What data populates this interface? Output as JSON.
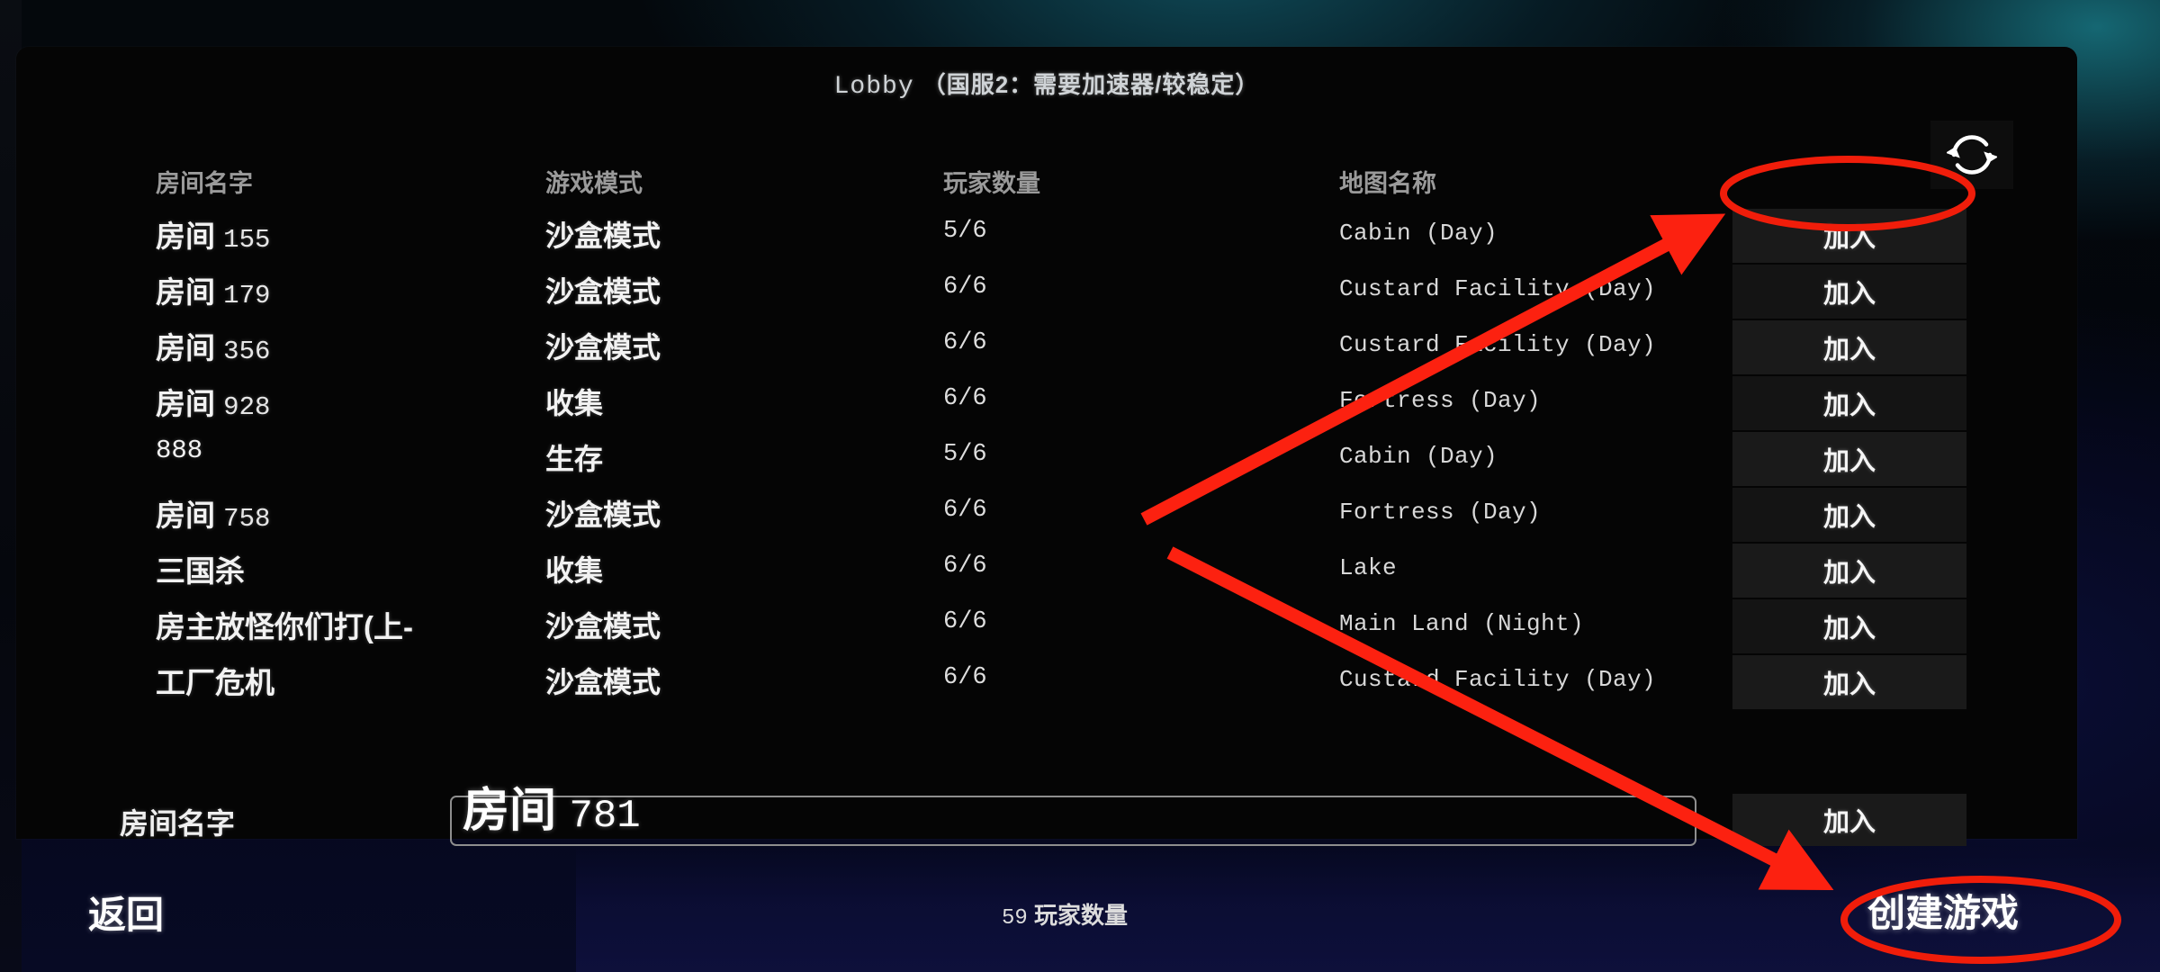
{
  "window": {
    "title_latin": "Lobby",
    "title_cn": "（国服2：需要加速器/较稳定）"
  },
  "toolbar": {
    "refresh_icon": "refresh-icon"
  },
  "table": {
    "headers": {
      "room_name": "房间名字",
      "game_mode": "游戏模式",
      "player_count": "玩家数量",
      "map_name": "地图名称"
    },
    "join_label": "加入",
    "rows": [
      {
        "name_prefix": "房间",
        "name_num": "155",
        "mode": "沙盒模式",
        "players": "5/6",
        "map": "Cabin (Day)",
        "join": "加入"
      },
      {
        "name_prefix": "房间",
        "name_num": "179",
        "mode": "沙盒模式",
        "players": "6/6",
        "map": "Custard Facility (Day)",
        "join": "加入"
      },
      {
        "name_prefix": "房间",
        "name_num": "356",
        "mode": "沙盒模式",
        "players": "6/6",
        "map": "Custard Facility (Day)",
        "join": "加入"
      },
      {
        "name_prefix": "房间",
        "name_num": "928",
        "mode": "收集",
        "players": "6/6",
        "map": "Fortress (Day)",
        "join": "加入"
      },
      {
        "name_prefix": "",
        "name_num": "888",
        "mode": "生存",
        "players": "5/6",
        "map": "Cabin (Day)",
        "join": "加入"
      },
      {
        "name_prefix": "房间",
        "name_num": "758",
        "mode": "沙盒模式",
        "players": "6/6",
        "map": "Fortress (Day)",
        "join": "加入"
      },
      {
        "name_prefix": "三国杀",
        "name_num": "",
        "mode": "收集",
        "players": "6/6",
        "map": "Lake",
        "join": "加入"
      },
      {
        "name_prefix": "房主放怪你们打(上-",
        "name_num": "",
        "mode": "沙盒模式",
        "players": "6/6",
        "map": "Main Land (Night)",
        "join": "加入"
      },
      {
        "name_prefix": "工厂危机",
        "name_num": "",
        "mode": "沙盒模式",
        "players": "6/6",
        "map": "Custard Facility (Day)",
        "join": "加入"
      }
    ]
  },
  "create_row": {
    "label": "房间名字",
    "input_prefix": "房间",
    "input_num": "781",
    "join_label": "加入"
  },
  "footer": {
    "back_label": "返回",
    "player_total_num": "59",
    "player_total_label": "玩家数量",
    "create_game_label": "创建游戏"
  },
  "annotations": {
    "highlight_color": "#f01d0a",
    "arrow_color": "#fc2110"
  }
}
